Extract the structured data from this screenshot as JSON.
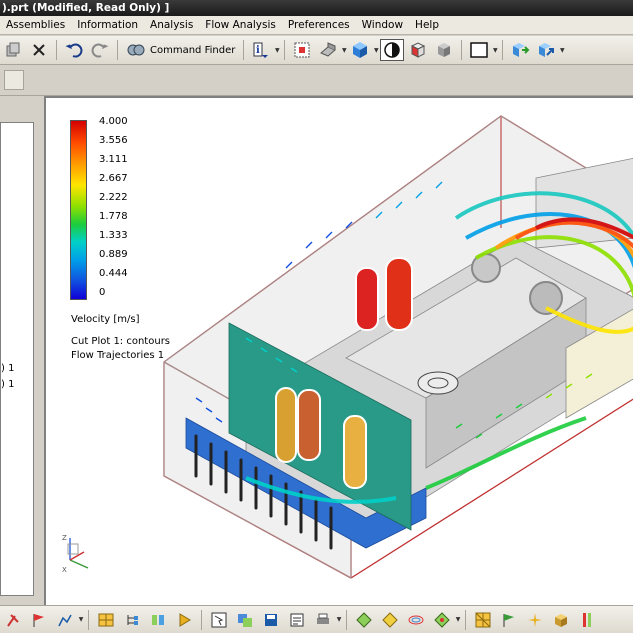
{
  "window": {
    "title": ").prt (Modified, Read Only) ]"
  },
  "menu": {
    "items": [
      {
        "label": "Assemblies",
        "underline": "A"
      },
      {
        "label": "Information",
        "underline": "I"
      },
      {
        "label": "Analysis",
        "underline": "n"
      },
      {
        "label": "Flow Analysis",
        "underline": "w"
      },
      {
        "label": "Preferences",
        "underline": "P"
      },
      {
        "label": "Window",
        "underline": "W"
      },
      {
        "label": "Help",
        "underline": "H"
      }
    ]
  },
  "toolbar": {
    "command_finder_label": "Command Finder",
    "icons": [
      "copy-icon",
      "delete-icon",
      "undo-icon",
      "redo-icon",
      "command-finder-icon",
      "info-icon",
      "fit-view-icon",
      "orient-view-icon",
      "shaded-cube-icon",
      "render-style-icon",
      "red-face-icon",
      "gray-face-icon",
      "background-icon",
      "move-icon",
      "move-arrow-icon"
    ]
  },
  "left_panel": {
    "fragments": [
      ") 1",
      ") 1"
    ]
  },
  "legend": {
    "title": "Velocity [m/s]",
    "ticks": [
      "4.000",
      "3.556",
      "3.111",
      "2.667",
      "2.222",
      "1.778",
      "1.333",
      "0.889",
      "0.444",
      "0"
    ],
    "min": 0,
    "max": 4.0,
    "colors": [
      "#d40000",
      "#ff4a00",
      "#ff9a00",
      "#ffe600",
      "#8ee000",
      "#1ccc3c",
      "#00d0c8",
      "#00a0e8",
      "#1050e0",
      "#1000d8"
    ]
  },
  "plots": {
    "cut_plot": "Cut Plot 1: contours",
    "trajectories": "Flow Trajectories 1"
  },
  "bottom_toolbar": {
    "icons": [
      "pin-icon",
      "flag-icon",
      "chart-icon",
      "grid-icon",
      "tree-icon",
      "play-icon",
      "compare-icon",
      "select-icon",
      "save-icon",
      "layers-icon",
      "print-icon",
      "diamond-icon",
      "diamond-check-icon",
      "rings-icon",
      "diamond-dot-icon",
      "mesh-icon",
      "flag2-icon",
      "report-icon",
      "sparkle-icon",
      "box-icon",
      "bars-icon"
    ]
  }
}
